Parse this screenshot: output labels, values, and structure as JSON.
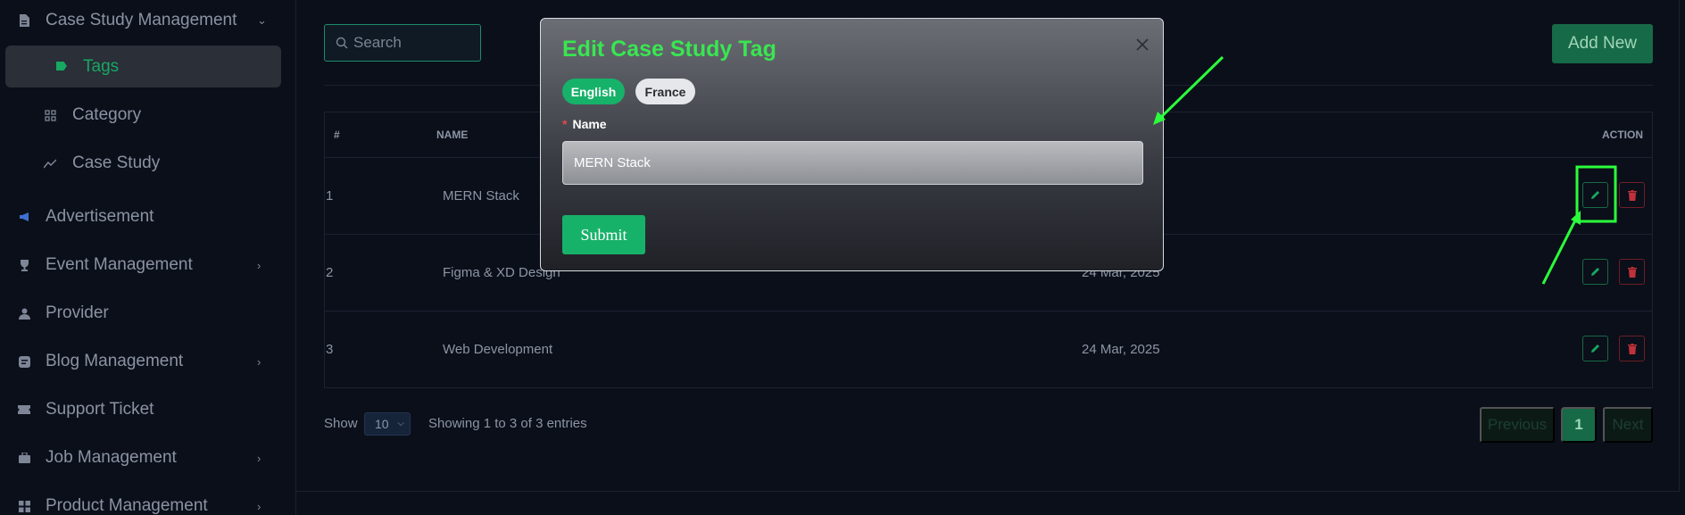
{
  "sidebar": {
    "items": [
      {
        "label": "Case Study Management",
        "icon": "file-icon",
        "expandable": true
      },
      {
        "label": "Tags",
        "icon": "tag-icon",
        "active": true
      },
      {
        "label": "Category",
        "icon": "grid-icon"
      },
      {
        "label": "Case Study",
        "icon": "trend-icon"
      },
      {
        "label": "Advertisement",
        "icon": "megaphone-icon"
      },
      {
        "label": "Event Management",
        "icon": "trophy-icon",
        "expandable": true
      },
      {
        "label": "Provider",
        "icon": "person-icon"
      },
      {
        "label": "Blog Management",
        "icon": "blog-icon",
        "expandable": true
      },
      {
        "label": "Support Ticket",
        "icon": "ticket-icon"
      },
      {
        "label": "Job Management",
        "icon": "briefcase-icon",
        "expandable": true
      },
      {
        "label": "Product Management",
        "icon": "box-icon",
        "expandable": true
      }
    ]
  },
  "toolbar": {
    "search_placeholder": "Search",
    "add_new_label": "Add New"
  },
  "table": {
    "headers": {
      "num": "#",
      "name": "NAME",
      "action": "ACTION"
    },
    "rows": [
      {
        "num": "1",
        "name": "MERN Stack",
        "date": ""
      },
      {
        "num": "2",
        "name": "Figma & XD Design",
        "date": "24 Mar, 2025"
      },
      {
        "num": "3",
        "name": "Web Development",
        "date": "24 Mar, 2025"
      }
    ]
  },
  "footer": {
    "show_label": "Show",
    "page_size": "10",
    "entries_text": "Showing 1 to 3 of 3 entries",
    "prev_label": "Previous",
    "current_page": "1",
    "next_label": "Next"
  },
  "modal": {
    "title": "Edit Case Study Tag",
    "lang_english": "English",
    "lang_france": "France",
    "required_mark": "*",
    "name_label": "Name",
    "name_value": "MERN Stack",
    "submit_label": "Submit"
  },
  "colors": {
    "accent_green": "#17b26a",
    "title_green": "#39e651",
    "annotation_green": "#2bff3c",
    "danger_red": "#e5484d"
  }
}
